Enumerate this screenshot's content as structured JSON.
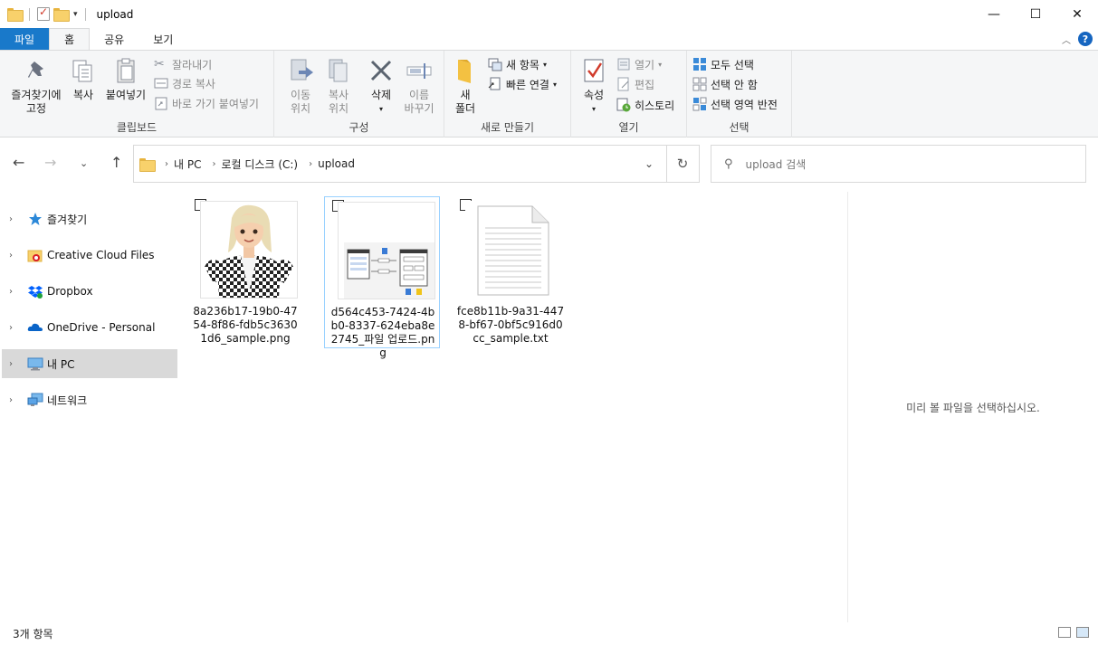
{
  "window": {
    "title": "upload",
    "controls": {
      "minimize": "—",
      "maximize": "☐",
      "close": "✕"
    }
  },
  "ribbon_tabs": [
    "파일",
    "홈",
    "공유",
    "보기"
  ],
  "ribbon": {
    "clipboard": {
      "group_label": "클립보드",
      "pin_line1": "즐겨찾기에",
      "pin_line2": "고정",
      "copy": "복사",
      "paste": "붙여넣기",
      "cut": "잘라내기",
      "copy_path": "경로 복사",
      "paste_shortcut": "바로 가기 붙여넣기"
    },
    "organize": {
      "group_label": "구성",
      "move_line1": "이동",
      "move_line2": "위치",
      "copy_line1": "복사",
      "copy_line2": "위치",
      "delete": "삭제",
      "rename_line1": "이름",
      "rename_line2": "바꾸기"
    },
    "new": {
      "group_label": "새로 만들기",
      "new_folder_line1": "새",
      "new_folder_line2": "폴더",
      "new_item": "새 항목",
      "easy_access": "빠른 연결"
    },
    "open": {
      "group_label": "열기",
      "properties": "속성",
      "open": "열기",
      "edit": "편집",
      "history": "히스토리"
    },
    "select": {
      "group_label": "선택",
      "select_all": "모두 선택",
      "select_none": "선택 안 함",
      "invert": "선택 영역 반전"
    }
  },
  "address": {
    "segments": [
      "내 PC",
      "로컬 디스크 (C:)",
      "upload"
    ],
    "search_placeholder": "upload 검색"
  },
  "nav_pane": [
    {
      "label": "즐겨찾기",
      "icon": "star-icon"
    },
    {
      "label": "Creative Cloud Files",
      "icon": "creative-cloud-folder-icon"
    },
    {
      "label": "Dropbox",
      "icon": "dropbox-icon"
    },
    {
      "label": "OneDrive - Personal",
      "icon": "onedrive-icon"
    },
    {
      "label": "내 PC",
      "icon": "pc-icon",
      "selected": true
    },
    {
      "label": "네트워크",
      "icon": "network-icon"
    }
  ],
  "files": [
    {
      "name": "8a236b17-19b0-4754-8f86-fdb5c36301d6_sample.png",
      "thumbnail": "avatar-image"
    },
    {
      "name": "d564c453-7424-4bb0-8337-624eba8e2745_파일 업로드.png",
      "thumbnail": "diagram-image",
      "selected": true
    },
    {
      "name": "fce8b11b-9a31-4478-bf67-0bf5c916d0cc_sample.txt",
      "thumbnail": "text-document-icon"
    }
  ],
  "preview_text": "미리 볼 파일을 선택하십시오.",
  "status": {
    "item_count": "3개 항목"
  },
  "colors": {
    "file_tab": "#1979ca",
    "selection_border": "#99d1ff",
    "folder": "#f8d16b"
  }
}
